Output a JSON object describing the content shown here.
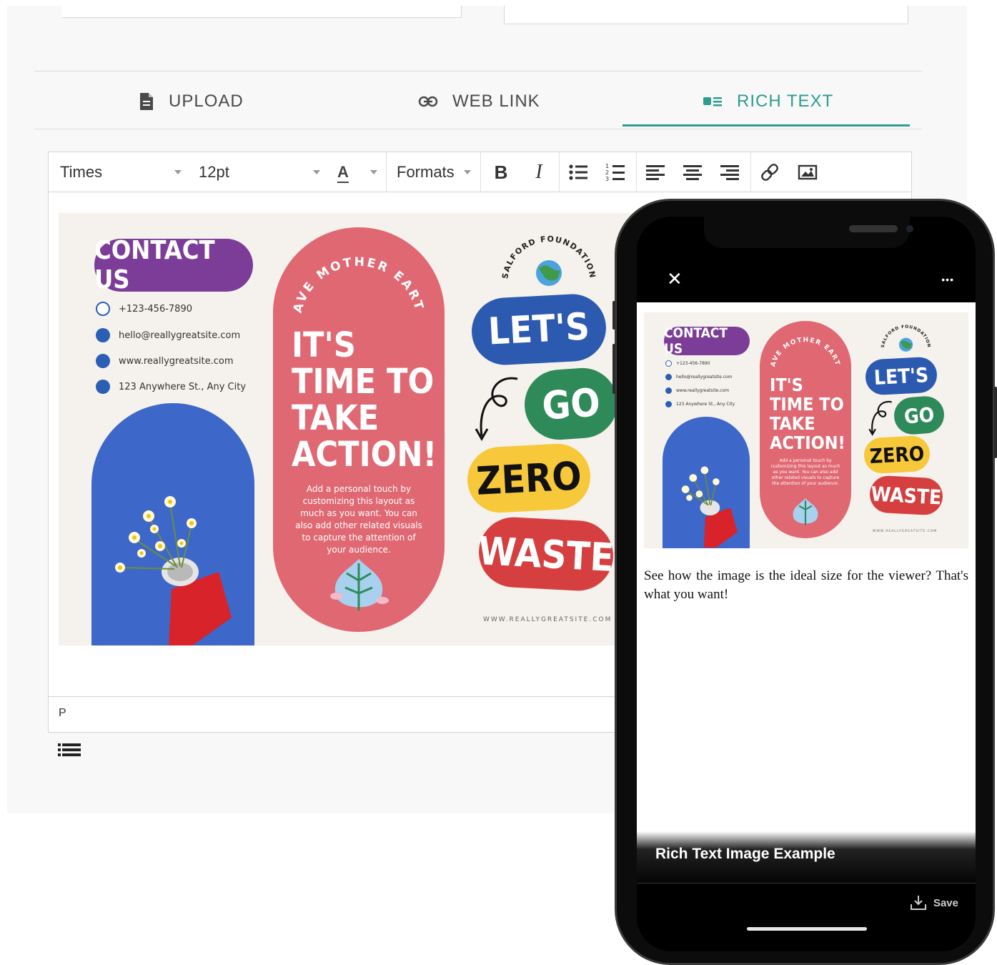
{
  "tabs": [
    {
      "label": "UPLOAD",
      "icon": "document-icon"
    },
    {
      "label": "WEB LINK",
      "icon": "link-icon"
    },
    {
      "label": "RICH TEXT",
      "icon": "rich-text-icon",
      "active": true
    }
  ],
  "colors": {
    "accent": "#2e9c90",
    "contact_purple": "#7b3d97",
    "arch_red": "#e06872",
    "arch_blue": "#3d67c9",
    "lets_blue": "#2c5ab0",
    "go_green": "#2f8a5a",
    "zero_yellow": "#f7c83a",
    "waste_red": "#d63f3f"
  },
  "toolbar": {
    "font_family": "Times",
    "font_size": "12pt",
    "text_color_glyph": "A",
    "formats_label": "Formats",
    "bold_glyph": "B",
    "italic_glyph": "I",
    "buttons": [
      "bold-icon",
      "italic-icon",
      "bullet-list-icon",
      "numbered-list-icon",
      "align-left-icon",
      "align-center-icon",
      "align-right-icon",
      "insert-link-icon",
      "insert-image-icon"
    ]
  },
  "statusbar": {
    "path": "P"
  },
  "brochure": {
    "contact_title": "CONTACT US",
    "phone": "+123-456-7890",
    "email": "hello@reallygreatsite.com",
    "website": "www.reallygreatsite.com",
    "address": "123 Anywhere St., Any City",
    "arch_curve_text": "SAVE MOTHER EARTH",
    "headline_lines": [
      "IT'S",
      "TIME TO",
      "TAKE",
      "ACTION!"
    ],
    "body": "Add a personal touch by customizing this layout as much as you want. You can also add other related visuals to capture the attention of your audience.",
    "foundation": "SALFORD FOUNDATION",
    "words": [
      "LET'S",
      "GO",
      "ZERO",
      "WASTE"
    ],
    "footer_url": "WWW.REALLYGREATSITE.COM"
  },
  "phone": {
    "close_glyph": "✕",
    "more_glyph": "•••",
    "caption": "See how the image is the ideal size for the viewer? That's what you want!",
    "title": "Rich Text Image Example",
    "save_label": "Save"
  }
}
